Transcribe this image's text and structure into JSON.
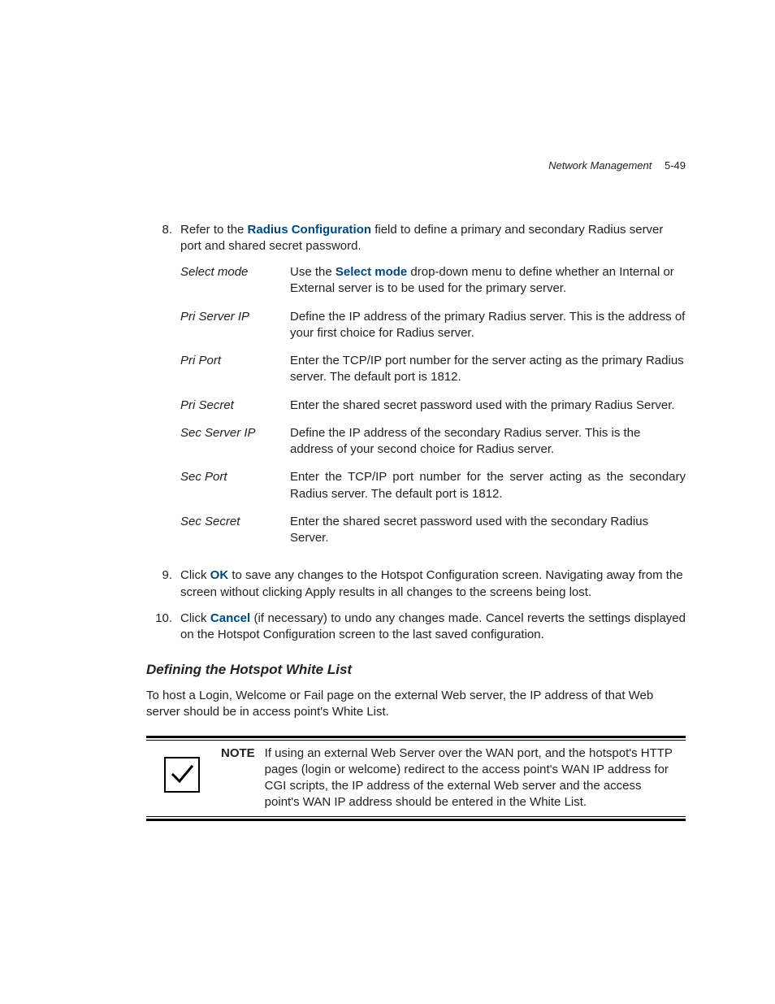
{
  "header": {
    "title": "Network Management",
    "page_num": "5-49"
  },
  "steps": {
    "s8": {
      "num": "8.",
      "pre": "Refer to the ",
      "bold": "Radius Configuration",
      "post": " field to define a primary and secondary Radius server port and shared secret password."
    },
    "s9": {
      "num": "9.",
      "pre": "Click ",
      "bold": "OK",
      "post": " to save any changes to the Hotspot Configuration screen. Navigating away from the screen without clicking Apply results in all changes to the screens being lost."
    },
    "s10": {
      "num": "10.",
      "pre": "Click ",
      "bold": "Cancel",
      "post": " (if necessary) to undo any changes made. Cancel reverts the settings displayed on the Hotspot Configuration screen to the last saved configuration."
    }
  },
  "defs": [
    {
      "term": "Select mode",
      "desc_pre": "Use the ",
      "desc_bold": "Select mode",
      "desc_post": " drop-down menu to define whether an Internal or External server is to be used for the primary server."
    },
    {
      "term": "Pri Server IP",
      "desc_pre": "",
      "desc_bold": "",
      "desc_post": "Define the IP address of the primary Radius server. This is the address of your first choice for Radius server."
    },
    {
      "term": "Pri Port",
      "desc_pre": "",
      "desc_bold": "",
      "desc_post": "Enter the TCP/IP port number for the server acting as the primary Radius server. The default port is 1812."
    },
    {
      "term": "Pri Secret",
      "desc_pre": "",
      "desc_bold": "",
      "desc_post": "Enter the shared secret password used with the primary Radius Server."
    },
    {
      "term": "Sec Server IP",
      "desc_pre": "",
      "desc_bold": "",
      "desc_post": "Define the IP address of the secondary Radius server. This is the address of your second choice for Radius server."
    },
    {
      "term": "Sec Port",
      "desc_pre": "",
      "desc_bold": "",
      "desc_post": "Enter the TCP/IP port number for the server acting as the secondary Radius server. The default port is 1812."
    },
    {
      "term": "Sec Secret",
      "desc_pre": "",
      "desc_bold": "",
      "desc_post": "Enter the shared secret password used with the secondary Radius Server."
    }
  ],
  "subhead": "Defining the Hotspot White List",
  "after_subhead": "To host a Login, Welcome or Fail page on the external Web server, the IP address of that Web server should be in access point's White List.",
  "note": {
    "label": "NOTE",
    "text": "If using an external Web Server over the WAN port, and the hotspot's HTTP pages (login or welcome) redirect to the access point's WAN IP address for CGI scripts, the IP address of the external Web server and the access point's WAN IP address should be entered in the White List."
  }
}
